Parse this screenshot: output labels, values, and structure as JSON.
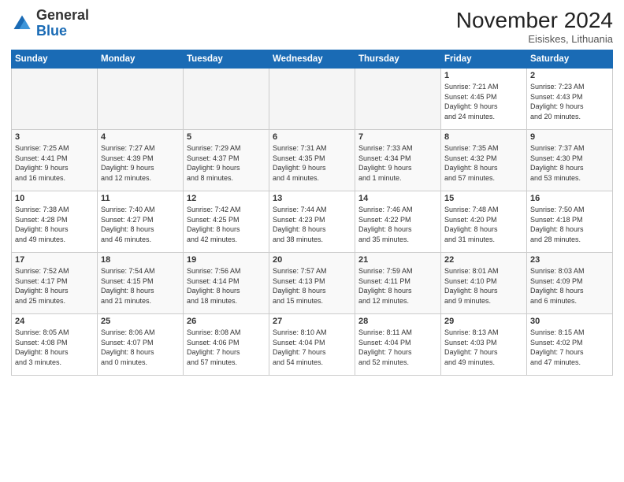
{
  "header": {
    "logo_general": "General",
    "logo_blue": "Blue",
    "month": "November 2024",
    "location": "Eisiskes, Lithuania"
  },
  "days_of_week": [
    "Sunday",
    "Monday",
    "Tuesday",
    "Wednesday",
    "Thursday",
    "Friday",
    "Saturday"
  ],
  "weeks": [
    [
      {
        "day": "",
        "info": ""
      },
      {
        "day": "",
        "info": ""
      },
      {
        "day": "",
        "info": ""
      },
      {
        "day": "",
        "info": ""
      },
      {
        "day": "",
        "info": ""
      },
      {
        "day": "1",
        "info": "Sunrise: 7:21 AM\nSunset: 4:45 PM\nDaylight: 9 hours\nand 24 minutes."
      },
      {
        "day": "2",
        "info": "Sunrise: 7:23 AM\nSunset: 4:43 PM\nDaylight: 9 hours\nand 20 minutes."
      }
    ],
    [
      {
        "day": "3",
        "info": "Sunrise: 7:25 AM\nSunset: 4:41 PM\nDaylight: 9 hours\nand 16 minutes."
      },
      {
        "day": "4",
        "info": "Sunrise: 7:27 AM\nSunset: 4:39 PM\nDaylight: 9 hours\nand 12 minutes."
      },
      {
        "day": "5",
        "info": "Sunrise: 7:29 AM\nSunset: 4:37 PM\nDaylight: 9 hours\nand 8 minutes."
      },
      {
        "day": "6",
        "info": "Sunrise: 7:31 AM\nSunset: 4:35 PM\nDaylight: 9 hours\nand 4 minutes."
      },
      {
        "day": "7",
        "info": "Sunrise: 7:33 AM\nSunset: 4:34 PM\nDaylight: 9 hours\nand 1 minute."
      },
      {
        "day": "8",
        "info": "Sunrise: 7:35 AM\nSunset: 4:32 PM\nDaylight: 8 hours\nand 57 minutes."
      },
      {
        "day": "9",
        "info": "Sunrise: 7:37 AM\nSunset: 4:30 PM\nDaylight: 8 hours\nand 53 minutes."
      }
    ],
    [
      {
        "day": "10",
        "info": "Sunrise: 7:38 AM\nSunset: 4:28 PM\nDaylight: 8 hours\nand 49 minutes."
      },
      {
        "day": "11",
        "info": "Sunrise: 7:40 AM\nSunset: 4:27 PM\nDaylight: 8 hours\nand 46 minutes."
      },
      {
        "day": "12",
        "info": "Sunrise: 7:42 AM\nSunset: 4:25 PM\nDaylight: 8 hours\nand 42 minutes."
      },
      {
        "day": "13",
        "info": "Sunrise: 7:44 AM\nSunset: 4:23 PM\nDaylight: 8 hours\nand 38 minutes."
      },
      {
        "day": "14",
        "info": "Sunrise: 7:46 AM\nSunset: 4:22 PM\nDaylight: 8 hours\nand 35 minutes."
      },
      {
        "day": "15",
        "info": "Sunrise: 7:48 AM\nSunset: 4:20 PM\nDaylight: 8 hours\nand 31 minutes."
      },
      {
        "day": "16",
        "info": "Sunrise: 7:50 AM\nSunset: 4:18 PM\nDaylight: 8 hours\nand 28 minutes."
      }
    ],
    [
      {
        "day": "17",
        "info": "Sunrise: 7:52 AM\nSunset: 4:17 PM\nDaylight: 8 hours\nand 25 minutes."
      },
      {
        "day": "18",
        "info": "Sunrise: 7:54 AM\nSunset: 4:15 PM\nDaylight: 8 hours\nand 21 minutes."
      },
      {
        "day": "19",
        "info": "Sunrise: 7:56 AM\nSunset: 4:14 PM\nDaylight: 8 hours\nand 18 minutes."
      },
      {
        "day": "20",
        "info": "Sunrise: 7:57 AM\nSunset: 4:13 PM\nDaylight: 8 hours\nand 15 minutes."
      },
      {
        "day": "21",
        "info": "Sunrise: 7:59 AM\nSunset: 4:11 PM\nDaylight: 8 hours\nand 12 minutes."
      },
      {
        "day": "22",
        "info": "Sunrise: 8:01 AM\nSunset: 4:10 PM\nDaylight: 8 hours\nand 9 minutes."
      },
      {
        "day": "23",
        "info": "Sunrise: 8:03 AM\nSunset: 4:09 PM\nDaylight: 8 hours\nand 6 minutes."
      }
    ],
    [
      {
        "day": "24",
        "info": "Sunrise: 8:05 AM\nSunset: 4:08 PM\nDaylight: 8 hours\nand 3 minutes."
      },
      {
        "day": "25",
        "info": "Sunrise: 8:06 AM\nSunset: 4:07 PM\nDaylight: 8 hours\nand 0 minutes."
      },
      {
        "day": "26",
        "info": "Sunrise: 8:08 AM\nSunset: 4:06 PM\nDaylight: 7 hours\nand 57 minutes."
      },
      {
        "day": "27",
        "info": "Sunrise: 8:10 AM\nSunset: 4:04 PM\nDaylight: 7 hours\nand 54 minutes."
      },
      {
        "day": "28",
        "info": "Sunrise: 8:11 AM\nSunset: 4:04 PM\nDaylight: 7 hours\nand 52 minutes."
      },
      {
        "day": "29",
        "info": "Sunrise: 8:13 AM\nSunset: 4:03 PM\nDaylight: 7 hours\nand 49 minutes."
      },
      {
        "day": "30",
        "info": "Sunrise: 8:15 AM\nSunset: 4:02 PM\nDaylight: 7 hours\nand 47 minutes."
      }
    ]
  ]
}
